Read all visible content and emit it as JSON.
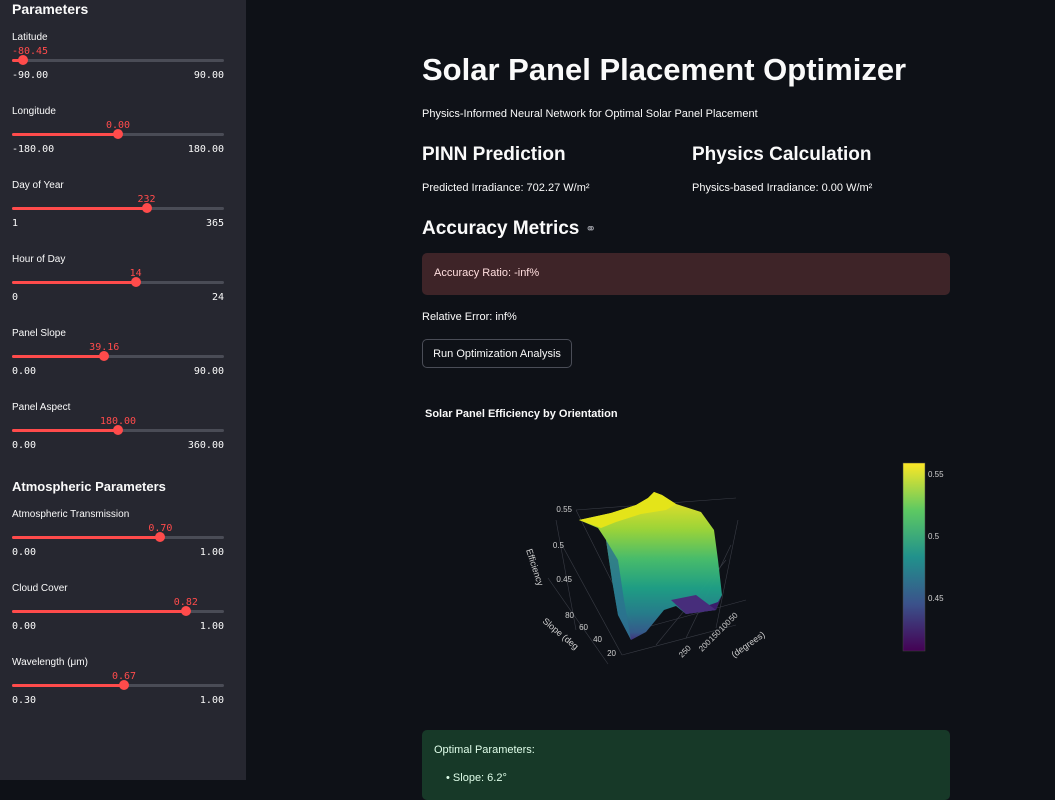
{
  "sidebar": {
    "title": "Parameters",
    "section_atmospheric": "Atmospheric Parameters",
    "sliders": [
      {
        "id": "latitude",
        "label": "Latitude",
        "value_text": "-80.45",
        "value": -80.45,
        "min": -90,
        "max": 90,
        "min_text": "-90.00",
        "max_text": "90.00"
      },
      {
        "id": "longitude",
        "label": "Longitude",
        "value_text": "0.00",
        "value": 0,
        "min": -180,
        "max": 180,
        "min_text": "-180.00",
        "max_text": "180.00"
      },
      {
        "id": "day",
        "label": "Day of Year",
        "value_text": "232",
        "value": 232,
        "min": 1,
        "max": 365,
        "min_text": "1",
        "max_text": "365"
      },
      {
        "id": "hour",
        "label": "Hour of Day",
        "value_text": "14",
        "value": 14,
        "min": 0,
        "max": 24,
        "min_text": "0",
        "max_text": "24"
      },
      {
        "id": "slope",
        "label": "Panel Slope",
        "value_text": "39.16",
        "value": 39.16,
        "min": 0,
        "max": 90,
        "min_text": "0.00",
        "max_text": "90.00"
      },
      {
        "id": "aspect",
        "label": "Panel Aspect",
        "value_text": "180.00",
        "value": 180,
        "min": 0,
        "max": 360,
        "min_text": "0.00",
        "max_text": "360.00"
      },
      {
        "id": "transmission",
        "label": "Atmospheric Transmission",
        "value_text": "0.70",
        "value": 0.7,
        "min": 0,
        "max": 1,
        "min_text": "0.00",
        "max_text": "1.00"
      },
      {
        "id": "cloud",
        "label": "Cloud Cover",
        "value_text": "0.82",
        "value": 0.82,
        "min": 0,
        "max": 1,
        "min_text": "0.00",
        "max_text": "1.00"
      },
      {
        "id": "wavelength",
        "label": "Wavelength (μm)",
        "value_text": "0.67",
        "value": 0.67,
        "min": 0.3,
        "max": 1,
        "min_text": "0.30",
        "max_text": "1.00"
      }
    ]
  },
  "main": {
    "title": "Solar Panel Placement Optimizer",
    "subtitle": "Physics-Informed Neural Network for Optimal Solar Panel Placement",
    "pinn_heading": "PINN Prediction",
    "pinn_text": "Predicted Irradiance: 702.27 W/m²",
    "physics_heading": "Physics Calculation",
    "physics_text": "Physics-based Irradiance: 0.00 W/m²",
    "accuracy_heading": "Accuracy Metrics",
    "accuracy_ratio": "Accuracy Ratio: -inf%",
    "relative_error": "Relative Error: inf%",
    "run_button": "Run Optimization Analysis",
    "optimal_title": "Optimal Parameters:",
    "optimal_slope": "Slope: 6.2°"
  },
  "plot": {
    "title": "Solar Panel Efficiency by Orientation",
    "z_axis_label": "Efficiency",
    "z_ticks": [
      "0.55",
      "0.5",
      "0.45"
    ],
    "y_axis_label": "Slope (deg",
    "y_ticks": [
      "80",
      "60",
      "40",
      "20"
    ],
    "x_axis_label": "(degrees)",
    "x_ticks": [
      "50",
      "100",
      "150",
      "200",
      "250"
    ],
    "colorbar_ticks": [
      "0.55",
      "0.5",
      "0.45"
    ],
    "colorbar_min": 0.41,
    "colorbar_max": 0.56,
    "colorscale": [
      "#440154",
      "#3b528b",
      "#21918c",
      "#5ec962",
      "#fde725"
    ]
  },
  "colors": {
    "accent": "#ff4b4b",
    "sidebar_bg": "#262730",
    "main_bg": "#0e1117",
    "error_bg": "#3e2428",
    "success_bg": "#173928"
  }
}
